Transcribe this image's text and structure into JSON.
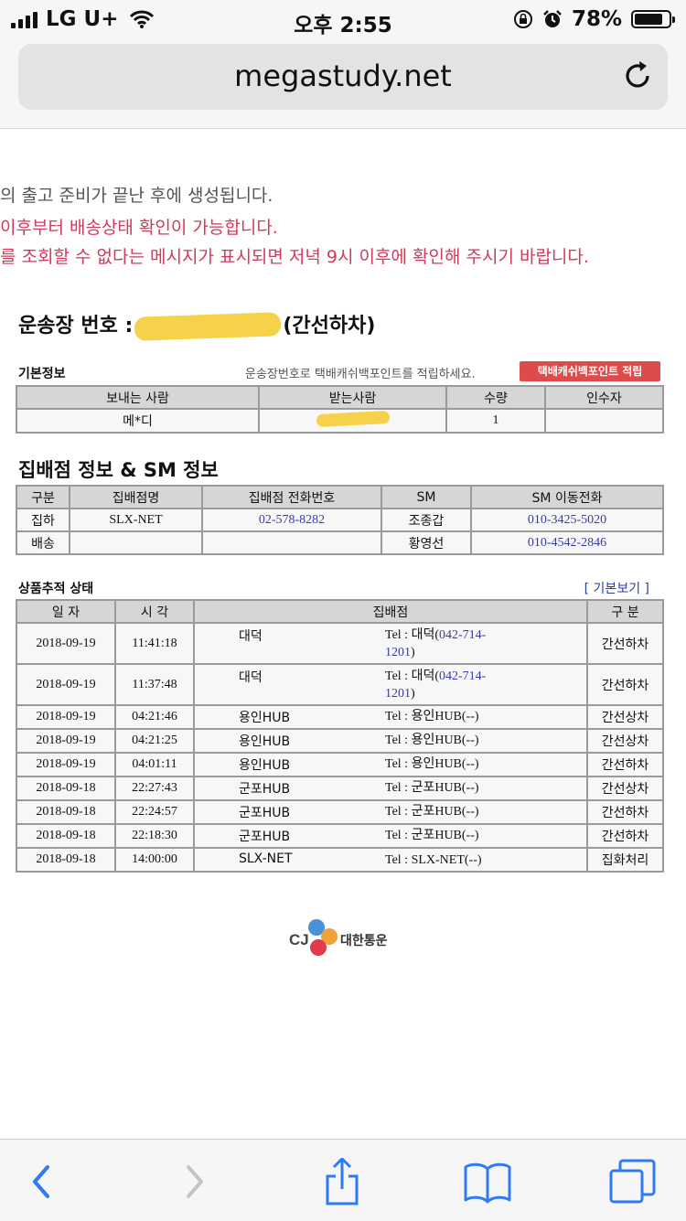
{
  "status_bar": {
    "carrier": "LG U+",
    "time": "오후 2:55",
    "battery": "78%"
  },
  "browser": {
    "url": "megastudy.net"
  },
  "notices": [
    {
      "text": "의 출고 준비가 끝난 후에 생성됩니다.",
      "tone": "gray"
    },
    {
      "text": "이후부터 배송상태 확인이 가능합니다.",
      "tone": "red"
    },
    {
      "text": "를 조회할 수 없다는 메시지가 표시되면 저녁 9시 이후에 확인해 주시기 바랍니다.",
      "tone": "red"
    }
  ],
  "waybill": {
    "label": "운송장 번호 :",
    "status_suffix": "(간선하차)"
  },
  "basic_info": {
    "label": "기본정보",
    "hint": "운송장번호로 택배캐쉬백포인트를 적립하세요.",
    "point_button": "택배캐쉬백포인트 적립",
    "headers": [
      "보내는 사람",
      "받는사람",
      "수량",
      "인수자"
    ],
    "row": {
      "sender": "메*디",
      "receiver": "",
      "quantity": "1",
      "acceptor": ""
    }
  },
  "branch_info": {
    "title": "집배점 정보 & SM 정보",
    "headers": [
      "구분",
      "집배점명",
      "집배점 전화번호",
      "SM",
      "SM 이동전화"
    ],
    "rows": [
      {
        "type": "집하",
        "branch": "SLX-NET",
        "phone": "02-578-8282",
        "sm": "조종갑",
        "mobile": "010-3425-5020"
      },
      {
        "type": "배송",
        "branch": "",
        "phone": "",
        "sm": "황영선",
        "mobile": "010-4542-2846"
      }
    ]
  },
  "tracking": {
    "label": "상품추적 상태",
    "basic_view_link": "[ 기본보기 ]",
    "headers": [
      "일 자",
      "시 각",
      "집배점",
      "구 분"
    ],
    "rows": [
      {
        "date": "2018-09-19",
        "time": "11:41:18",
        "branch": "대덕",
        "tel_prefix": "Tel : 대덕(",
        "tel_number": "042-714-1201",
        "tel_suffix": ")",
        "status": "간선하차"
      },
      {
        "date": "2018-09-19",
        "time": "11:37:48",
        "branch": "대덕",
        "tel_prefix": "Tel : 대덕(",
        "tel_number": "042-714-1201",
        "tel_suffix": ")",
        "status": "간선하차"
      },
      {
        "date": "2018-09-19",
        "time": "04:21:46",
        "branch": "용인HUB",
        "tel_prefix": "Tel : 용인HUB(--)",
        "tel_number": "",
        "tel_suffix": "",
        "status": "간선상차"
      },
      {
        "date": "2018-09-19",
        "time": "04:21:25",
        "branch": "용인HUB",
        "tel_prefix": "Tel : 용인HUB(--)",
        "tel_number": "",
        "tel_suffix": "",
        "status": "간선상차"
      },
      {
        "date": "2018-09-19",
        "time": "04:01:11",
        "branch": "용인HUB",
        "tel_prefix": "Tel : 용인HUB(--)",
        "tel_number": "",
        "tel_suffix": "",
        "status": "간선하차"
      },
      {
        "date": "2018-09-18",
        "time": "22:27:43",
        "branch": "군포HUB",
        "tel_prefix": "Tel : 군포HUB(--)",
        "tel_number": "",
        "tel_suffix": "",
        "status": "간선상차"
      },
      {
        "date": "2018-09-18",
        "time": "22:24:57",
        "branch": "군포HUB",
        "tel_prefix": "Tel : 군포HUB(--)",
        "tel_number": "",
        "tel_suffix": "",
        "status": "간선하차"
      },
      {
        "date": "2018-09-18",
        "time": "22:18:30",
        "branch": "군포HUB",
        "tel_prefix": "Tel : 군포HUB(--)",
        "tel_number": "",
        "tel_suffix": "",
        "status": "간선하차"
      },
      {
        "date": "2018-09-18",
        "time": "14:00:00",
        "branch": "SLX-NET",
        "tel_prefix": "Tel : SLX-NET(--)",
        "tel_number": "",
        "tel_suffix": "",
        "status": "집화처리"
      }
    ]
  },
  "footer": {
    "logo_mark": "CJ",
    "logo_text": "대한통운"
  },
  "toolbar_icons": [
    "back-icon",
    "forward-icon",
    "share-icon",
    "bookmarks-icon",
    "tabs-icon"
  ]
}
